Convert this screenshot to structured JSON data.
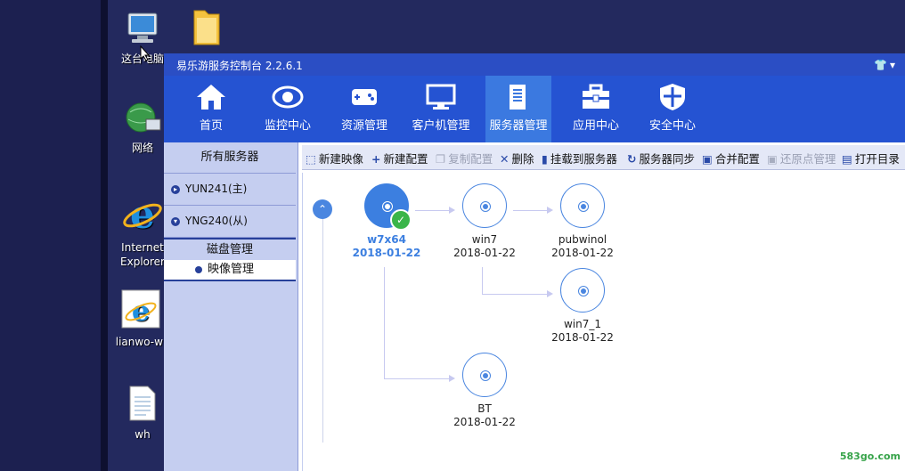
{
  "desktop": {
    "icons": [
      {
        "label": "这台电脑"
      },
      {
        "label": ""
      },
      {
        "label": "网络"
      },
      {
        "label": "Internet Explorer"
      },
      {
        "label": "lianwo-wi"
      },
      {
        "label": "wh"
      }
    ]
  },
  "window": {
    "title": "易乐游服务控制台 2.2.6.1"
  },
  "nav": {
    "items": [
      {
        "label": "首页",
        "icon": "home-icon"
      },
      {
        "label": "监控中心",
        "icon": "eye-icon"
      },
      {
        "label": "资源管理",
        "icon": "gamepad-icon"
      },
      {
        "label": "客户机管理",
        "icon": "monitor-icon"
      },
      {
        "label": "服务器管理",
        "icon": "server-icon"
      },
      {
        "label": "应用中心",
        "icon": "toolbox-icon"
      },
      {
        "label": "安全中心",
        "icon": "shield-icon"
      }
    ],
    "active": "服务器管理"
  },
  "sidebar": {
    "header": "所有服务器",
    "servers": [
      {
        "label": "YUN241(主)"
      },
      {
        "label": "YNG240(从)"
      }
    ],
    "section": "磁盘管理",
    "sub_item": "映像管理"
  },
  "toolbar": {
    "items": [
      {
        "label": "新建映像",
        "icon": "new-image-icon",
        "enabled": true
      },
      {
        "label": "新建配置",
        "icon": "plus-icon",
        "enabled": true
      },
      {
        "label": "复制配置",
        "icon": "copy-icon",
        "enabled": false
      },
      {
        "label": "删除",
        "icon": "delete-icon",
        "enabled": true
      },
      {
        "label": "挂载到服务器",
        "icon": "mount-icon",
        "enabled": true
      },
      {
        "label": "服务器同步",
        "icon": "sync-icon",
        "enabled": true
      },
      {
        "label": "合并配置",
        "icon": "merge-icon",
        "enabled": true
      },
      {
        "label": "还原点管理",
        "icon": "lock-icon",
        "enabled": false
      },
      {
        "label": "打开目录",
        "icon": "folder-icon",
        "enabled": true
      }
    ]
  },
  "tree": {
    "nodes": [
      {
        "name": "w7x64",
        "date": "2018-01-22",
        "root": true
      },
      {
        "name": "win7",
        "date": "2018-01-22"
      },
      {
        "name": "pubwinol",
        "date": "2018-01-22"
      },
      {
        "name": "win7_1",
        "date": "2018-01-22"
      },
      {
        "name": "BT",
        "date": "2018-01-22"
      }
    ]
  },
  "watermark": "583go.com",
  "colors": {
    "nav_bg": "#2553d2",
    "nav_active": "#3b79e0",
    "accent": "#3c7fe0",
    "check": "#3ab54a"
  }
}
